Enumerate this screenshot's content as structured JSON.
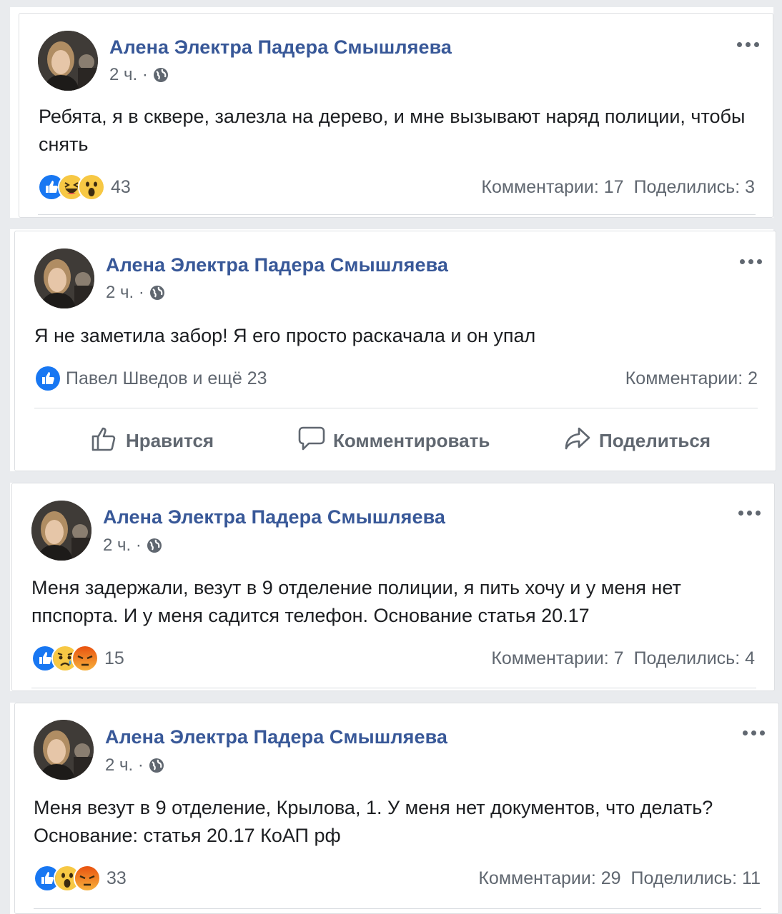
{
  "posts": [
    {
      "author": "Алена Электра Падера Смышляева",
      "time": "2 ч. ·",
      "text": "Ребята, я в сквере, залезла на дерево, и мне вызывают наряд полиции, чтобы снять",
      "reactions": [
        "like-icon",
        "laugh-icon",
        "wow-icon"
      ],
      "reaction_count": "43",
      "comments": "Комментарии: 17",
      "shares": "Поделились: 3"
    },
    {
      "author": "Алена Электра Падера Смышляева",
      "time": "2 ч. ·",
      "text": "Я не заметила забор! Я его просто раскачала и он упал",
      "reactions": [
        "like-icon"
      ],
      "reaction_count": "Павел Шведов и ещё 23",
      "comments": "Комментарии: 2",
      "actions": {
        "like": "Нравится",
        "comment": "Комментировать",
        "share": "Поделиться"
      }
    },
    {
      "author": "Алена Электра Падера Смышляева",
      "time": "2 ч. ·",
      "text": "Меня задержали, везут в 9 отделение полиции, я пить хочу и у меня нет ппспорта. И у меня садится телефон. Основание статья 20.17",
      "reactions": [
        "like-icon",
        "sad-icon",
        "angry-icon"
      ],
      "reaction_count": "15",
      "comments": "Комментарии: 7",
      "shares": "Поделились: 4"
    },
    {
      "author": "Алена Электра Падера Смышляева",
      "time": "2 ч. ·",
      "text": "Меня везут в 9 отделение, Крылова, 1. У меня нет документов, что делать? Основание: статья 20.17 КоАП рф",
      "reactions": [
        "like-icon",
        "wow-icon",
        "angry-icon"
      ],
      "reaction_count": "33",
      "comments": "Комментарии: 29",
      "shares": "Поделились: 11"
    }
  ],
  "colors": {
    "author": "#385898",
    "meta": "#606770",
    "text": "#1c1e21",
    "like": "#1877f2",
    "emoji": "#f7c844",
    "angry": "#e9710f"
  }
}
